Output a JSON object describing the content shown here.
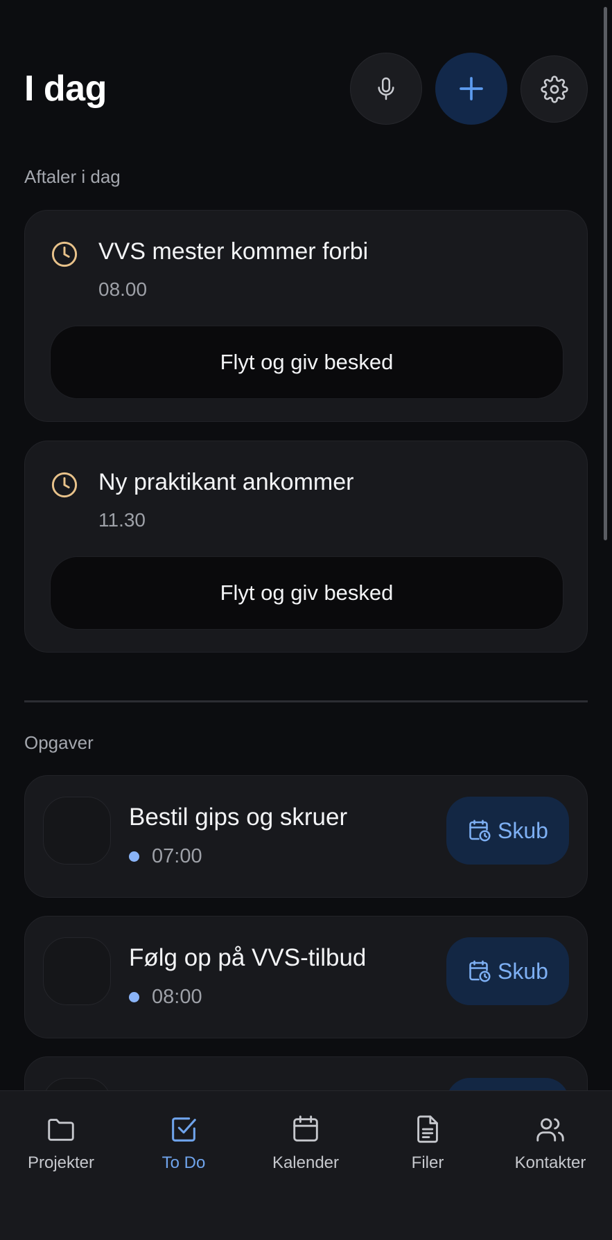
{
  "header": {
    "title": "I dag",
    "mic_icon": "microphone-icon",
    "add_icon": "plus-icon",
    "settings_icon": "gear-icon"
  },
  "appointments": {
    "section_label": "Aftaler i dag",
    "items": [
      {
        "title": "VVS mester kommer forbi",
        "time": "08.00",
        "action": "Flyt og giv besked"
      },
      {
        "title": "Ny praktikant ankommer",
        "time": "11.30",
        "action": "Flyt og giv besked"
      }
    ]
  },
  "tasks": {
    "section_label": "Opgaver",
    "skub_label": "Skub",
    "items": [
      {
        "title": "Bestil gips og skruer",
        "time": "07:00"
      },
      {
        "title": "Følg op på VVS-tilbud",
        "time": "08:00"
      }
    ]
  },
  "nav": {
    "items": [
      {
        "label": "Projekter",
        "icon": "folder-icon",
        "active": false
      },
      {
        "label": "To Do",
        "icon": "checkbox-icon",
        "active": true
      },
      {
        "label": "Kalender",
        "icon": "calendar-icon",
        "active": false
      },
      {
        "label": "Filer",
        "icon": "file-icon",
        "active": false
      },
      {
        "label": "Kontakter",
        "icon": "users-icon",
        "active": false
      }
    ]
  },
  "colors": {
    "background": "#0c0d10",
    "card": "#18191d",
    "accent": "#6fa4ec",
    "clock": "#e8c28a"
  }
}
